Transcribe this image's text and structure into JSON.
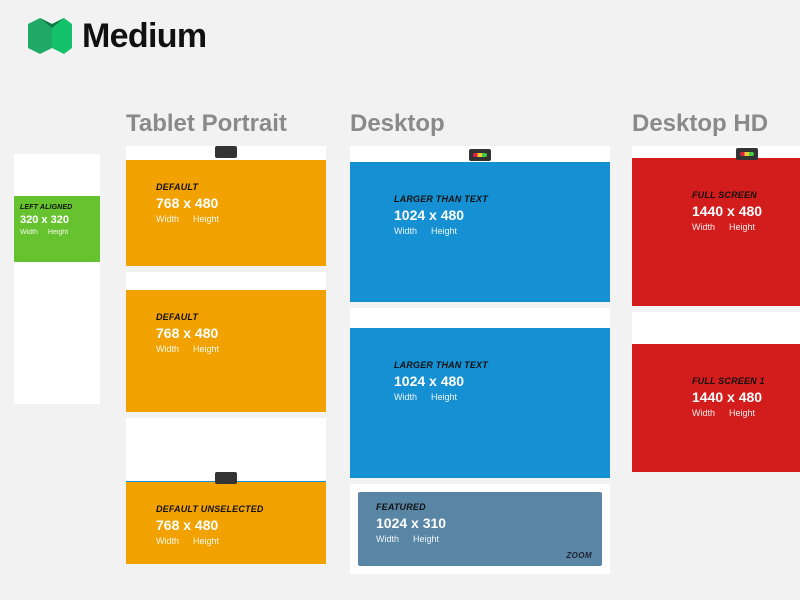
{
  "brand": {
    "name": "Medium"
  },
  "wh": {
    "width": "Width",
    "height": "Height"
  },
  "columns": {
    "mobile": {
      "card": {
        "label": "LEFT ALIGNED",
        "dims": "320 x 320"
      }
    },
    "tablet": {
      "title": "Tablet Portrait",
      "frame1": {
        "label": "DEFAULT",
        "dims": "768 x 480"
      },
      "frame2": {
        "label": "DEFAULT",
        "dims": "768 x 480"
      },
      "frame3": {
        "label": "DEFAULT UNSELECTED",
        "dims": "768 x 480"
      }
    },
    "desktop": {
      "title": "Desktop",
      "frame1": {
        "label": "LARGER THAN TEXT",
        "dims": "1024 x 480"
      },
      "frame2": {
        "label": "LARGER THAN TEXT",
        "dims": "1024 x 480"
      },
      "frame3": {
        "label": "Featured",
        "dims": "1024 x 310",
        "zoom": "ZOOM"
      }
    },
    "hd": {
      "title": "Desktop HD",
      "frame1": {
        "label": "FULL SCREEN",
        "dims": "1440 x 480"
      },
      "frame2": {
        "label": "FULL SCREEN 1",
        "dims": "1440 x 480"
      }
    }
  }
}
